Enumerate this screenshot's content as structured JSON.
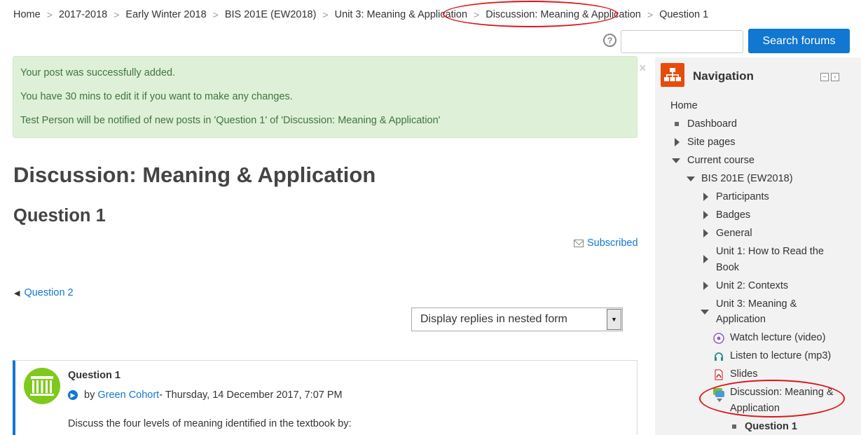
{
  "breadcrumb": {
    "items": [
      "Home",
      "2017-2018",
      "Early Winter 2018",
      "BIS 201E (EW2018)",
      "Unit 3: Meaning & Application",
      "Discussion: Meaning & Application",
      "Question 1"
    ]
  },
  "search": {
    "button_label": "Search forums",
    "placeholder": "",
    "value": ""
  },
  "alert": {
    "line1": "Your post was successfully added.",
    "line2": "You have 30 mins to edit it if you want to make any changes.",
    "line3": "Test Person will be notified of new posts in 'Question 1' of 'Discussion: Meaning & Application'",
    "close": "×"
  },
  "forum_title": "Discussion: Meaning & Application",
  "discussion_title": "Question 1",
  "subscribed_label": "Subscribed",
  "prev_discussion": "Question 2",
  "display_mode": {
    "selected": "Display replies in nested form"
  },
  "post": {
    "subject": "Question 1",
    "by": "by",
    "author": "Green Cohort",
    "date": " - Thursday, 14 December 2017, 7:07 PM",
    "body": "Discuss the four levels of meaning identified in the textbook by:"
  },
  "navigation": {
    "title": "Navigation",
    "items": {
      "home": "Home",
      "dashboard": "Dashboard",
      "site_pages": "Site pages",
      "current_course": "Current course",
      "course": "BIS 201E (EW2018)",
      "participants": "Participants",
      "badges": "Badges",
      "general": "General",
      "unit1_a": "Unit 1: How to Read the",
      "unit1_b": "Book",
      "unit2": "Unit 2: Contexts",
      "unit3_a": "Unit 3: Meaning &",
      "unit3_b": "Application",
      "watch": "Watch lecture (video)",
      "listen": "Listen to lecture (mp3)",
      "slides": "Slides",
      "discussion_a": "Discussion: Meaning &",
      "discussion_b": "Application",
      "question1": "Question 1"
    }
  },
  "colors": {
    "link": "#1177d1",
    "alert_bg": "#dff0d8",
    "alert_text": "#3c763d",
    "annotation": "#e0161c",
    "nav_icon": "#e74c0b"
  }
}
